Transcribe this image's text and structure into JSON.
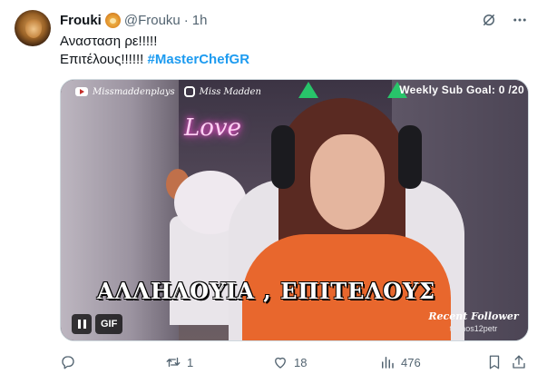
{
  "author": {
    "display_name": "Frouki",
    "name_emoji": "lion-emoji",
    "handle": "@Frouku",
    "separator": "·",
    "time": "1h"
  },
  "header_icons": [
    "grok-icon",
    "more-icon"
  ],
  "tweet": {
    "line1": "Ανασταση ρε!!!!!",
    "line2_text": "Επιτέλους!!!!!! ",
    "hashtag": "#MasterChefGR"
  },
  "media": {
    "overlay_youtube": "Missmaddenplays",
    "overlay_instagram": "Miss Madden",
    "sub_goal": "Weekly Sub Goal: 0 /20",
    "neon_sign": "Love",
    "caption": "ΑΛΛΗΛΟΥΙΑ , ΕΠΙΤΕΛΟΥΣ",
    "follower_title": "Recent Follower",
    "follower_name": "thanos12petr",
    "gif_label": "GIF"
  },
  "actions": {
    "reply_count": "",
    "retweet_count": "1",
    "like_count": "18",
    "views_count": "476"
  },
  "colors": {
    "accent": "#1d9bf0",
    "text": "#0f1419",
    "muted": "#536471"
  }
}
